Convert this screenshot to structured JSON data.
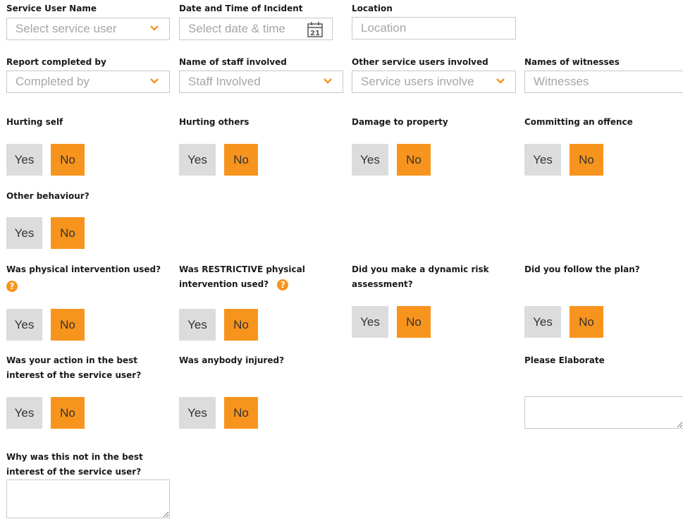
{
  "fields": {
    "service_user": {
      "label": "Service User Name",
      "placeholder": "Select service user"
    },
    "datetime": {
      "label": "Date and Time of Incident",
      "placeholder": "Select date & time",
      "calendar_day": "21"
    },
    "location": {
      "label": "Location",
      "placeholder": "Location"
    },
    "report_by": {
      "label": "Report completed by",
      "placeholder": "Completed by"
    },
    "staff": {
      "label": "Name of staff involved",
      "placeholder": "Staff Involved"
    },
    "other_users": {
      "label": "Other service users involved",
      "placeholder": "Service users involve"
    },
    "witnesses": {
      "label": "Names of witnesses",
      "placeholder": "Witnesses"
    }
  },
  "questions": {
    "hurting_self": {
      "label": "Hurting self",
      "selected": "No"
    },
    "hurting_others": {
      "label": "Hurting others",
      "selected": "No"
    },
    "damage_property": {
      "label": "Damage to property",
      "selected": "No"
    },
    "offence": {
      "label": "Committing an offence",
      "selected": "No"
    },
    "other_behaviour": {
      "label": "Other behaviour?",
      "selected": "No"
    },
    "physical": {
      "label": "Was physical intervention used?",
      "selected": "No"
    },
    "restrictive": {
      "label_pre": "Was ",
      "label_strong": "RESTRICTIVE",
      "label_mid": " physical",
      "label_line2": "intervention used?",
      "selected": "No"
    },
    "dynamic_risk": {
      "label_line1": "Did you make a dynamic risk",
      "label_line2": "assessment?",
      "selected": "No"
    },
    "follow_plan": {
      "label": "Did you follow the plan?",
      "selected": "No"
    },
    "best_interest": {
      "label_line1": "Was your action in the best",
      "label_line2": "interest of the service user?",
      "selected": "No"
    },
    "injured": {
      "label": "Was anybody injured?",
      "selected": "No"
    }
  },
  "please_elaborate": {
    "label": "Please Elaborate"
  },
  "why_not": {
    "label_line1": "Why was this not in the best",
    "label_line2": "interest of the service user?"
  },
  "buttons": {
    "yes": "Yes",
    "no": "No"
  },
  "help_icon_glyph": "?",
  "colors": {
    "accent": "#f7941d",
    "yes_bg": "#dcdcdc",
    "border": "#c8c8c8",
    "placeholder": "#a6a6a6"
  }
}
